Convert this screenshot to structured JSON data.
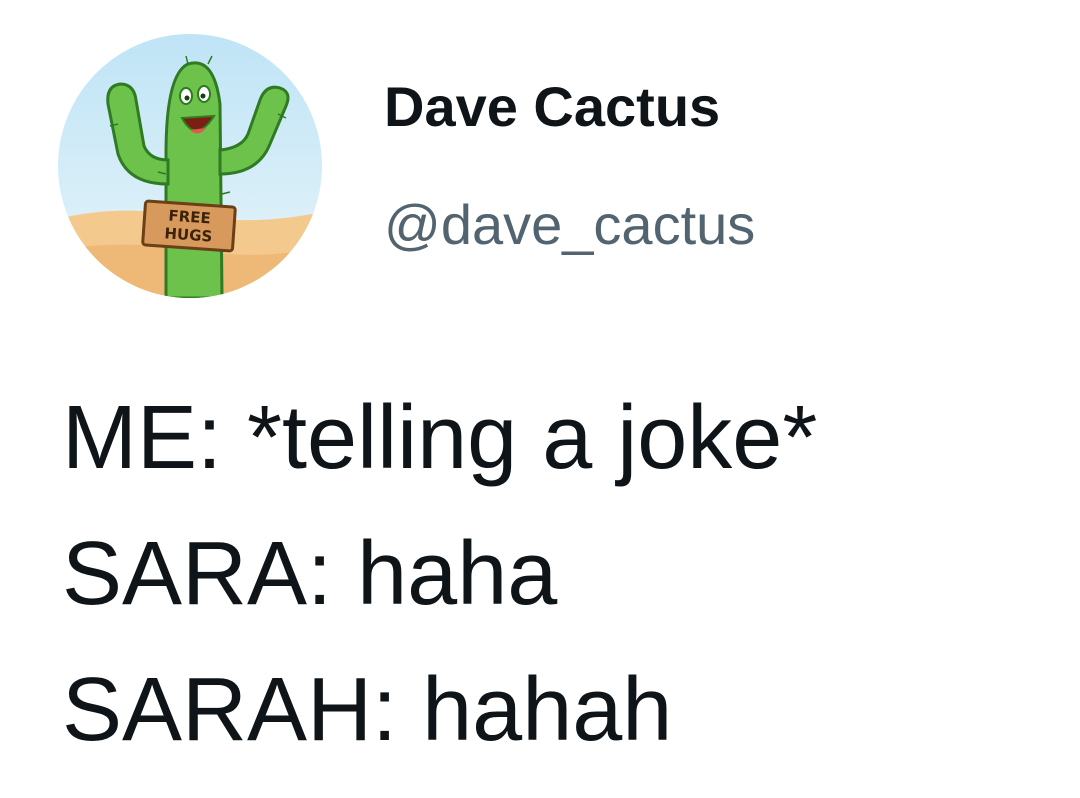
{
  "author": {
    "display_name": "Dave Cactus",
    "handle": "@dave_cactus",
    "avatar_icon": "cactus-free-hugs-avatar",
    "avatar_sign_text": "FREE HUGS"
  },
  "tweet": {
    "lines": [
      "ME: *telling a joke*",
      "SARA: haha",
      "SARAH: hahah"
    ]
  },
  "colors": {
    "text_primary": "#0f1419",
    "text_secondary": "#536471",
    "background": "#ffffff"
  }
}
